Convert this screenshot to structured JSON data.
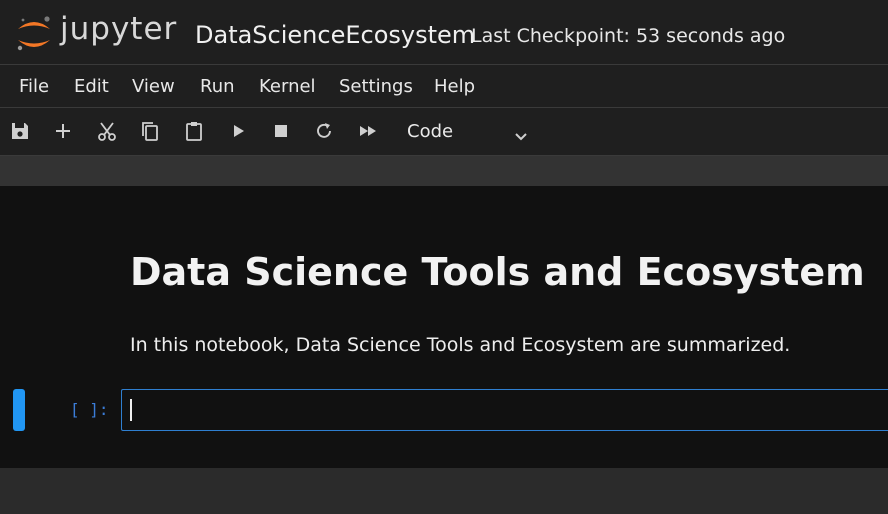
{
  "app": {
    "logo_name": "jupyter",
    "notebook_title": "DataScienceEcosystem",
    "checkpoint": "Last Checkpoint: 53 seconds ago",
    "colors": {
      "logo_orange": "#f37726",
      "accent_blue": "#2196f3",
      "prompt_blue": "#3b7dd8"
    }
  },
  "menu": {
    "items": [
      "File",
      "Edit",
      "View",
      "Run",
      "Kernel",
      "Settings",
      "Help"
    ]
  },
  "toolbar": {
    "icons": [
      "save-icon",
      "add-icon",
      "cut-icon",
      "copy-icon",
      "paste-icon",
      "run-icon",
      "stop-icon",
      "restart-icon",
      "fast-forward-icon"
    ],
    "cell_type": "Code",
    "cell_type_icon": "chevron-down-icon"
  },
  "cells": {
    "markdown": {
      "heading": "Data Science Tools and Ecosystem",
      "paragraph": "In this notebook, Data Science Tools and Ecosystem are summarized."
    },
    "code": {
      "prompt": "[ ]:",
      "value": ""
    }
  }
}
